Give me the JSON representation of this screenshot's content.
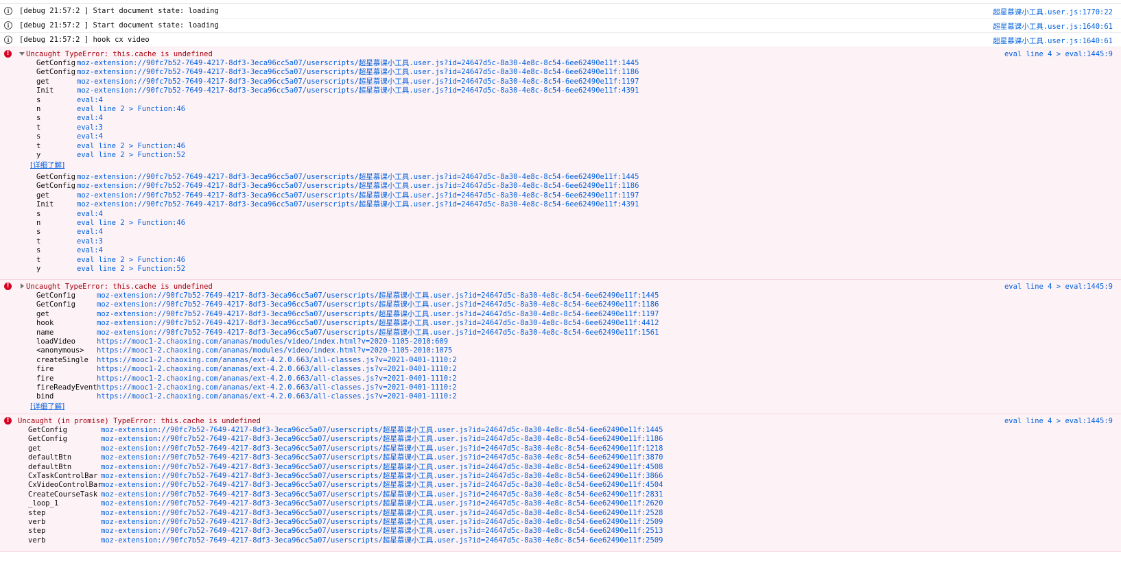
{
  "info_rows": [
    {
      "msg": "[debug 21:57:2 ] Start document state: loading",
      "src": "超星慕课小工具.user.js:1770:22"
    },
    {
      "msg": "[debug 21:57:2 ] Start document state: loading",
      "src": "超星慕课小工具.user.js:1640:61"
    },
    {
      "msg": "[debug 21:57:2 ] hook cx video",
      "src": "超星慕课小工具.user.js:1640:61"
    }
  ],
  "errors": [
    {
      "title": "Uncaught TypeError: this.cache is undefined",
      "src": "eval line 4 > eval:1445:9",
      "learn_more": "[详细了解]",
      "trace1": [
        [
          "GetConfig",
          "moz-extension://90fc7b52-7649-4217-8df3-3eca96cc5a07/userscripts/超星慕课小工具.user.js?id=24647d5c-8a30-4e8c-8c54-6ee62490e11f:1445"
        ],
        [
          "GetConfig",
          "moz-extension://90fc7b52-7649-4217-8df3-3eca96cc5a07/userscripts/超星慕课小工具.user.js?id=24647d5c-8a30-4e8c-8c54-6ee62490e11f:1186"
        ],
        [
          "get",
          "moz-extension://90fc7b52-7649-4217-8df3-3eca96cc5a07/userscripts/超星慕课小工具.user.js?id=24647d5c-8a30-4e8c-8c54-6ee62490e11f:1197"
        ],
        [
          "Init",
          "moz-extension://90fc7b52-7649-4217-8df3-3eca96cc5a07/userscripts/超星慕课小工具.user.js?id=24647d5c-8a30-4e8c-8c54-6ee62490e11f:4391"
        ],
        [
          "s",
          "eval:4"
        ],
        [
          "n",
          "eval line 2 > Function:46"
        ],
        [
          "s",
          "eval:4"
        ],
        [
          "t",
          "eval:3"
        ],
        [
          "s",
          "eval:4"
        ],
        [
          "t",
          "eval line 2 > Function:46"
        ],
        [
          "y",
          "eval line 2 > Function:52"
        ]
      ],
      "trace2": [
        [
          "GetConfig",
          "moz-extension://90fc7b52-7649-4217-8df3-3eca96cc5a07/userscripts/超星慕课小工具.user.js?id=24647d5c-8a30-4e8c-8c54-6ee62490e11f:1445"
        ],
        [
          "GetConfig",
          "moz-extension://90fc7b52-7649-4217-8df3-3eca96cc5a07/userscripts/超星慕课小工具.user.js?id=24647d5c-8a30-4e8c-8c54-6ee62490e11f:1186"
        ],
        [
          "get",
          "moz-extension://90fc7b52-7649-4217-8df3-3eca96cc5a07/userscripts/超星慕课小工具.user.js?id=24647d5c-8a30-4e8c-8c54-6ee62490e11f:1197"
        ],
        [
          "Init",
          "moz-extension://90fc7b52-7649-4217-8df3-3eca96cc5a07/userscripts/超星慕课小工具.user.js?id=24647d5c-8a30-4e8c-8c54-6ee62490e11f:4391"
        ],
        [
          "s",
          "eval:4"
        ],
        [
          "n",
          "eval line 2 > Function:46"
        ],
        [
          "s",
          "eval:4"
        ],
        [
          "t",
          "eval:3"
        ],
        [
          "s",
          "eval:4"
        ],
        [
          "t",
          "eval line 2 > Function:46"
        ],
        [
          "y",
          "eval line 2 > Function:52"
        ]
      ]
    },
    {
      "title": "Uncaught TypeError: this.cache is undefined",
      "src": "eval line 4 > eval:1445:9",
      "learn_more": "[详细了解]",
      "trace1": [
        [
          "GetConfig",
          "moz-extension://90fc7b52-7649-4217-8df3-3eca96cc5a07/userscripts/超星慕课小工具.user.js?id=24647d5c-8a30-4e8c-8c54-6ee62490e11f:1445"
        ],
        [
          "GetConfig",
          "moz-extension://90fc7b52-7649-4217-8df3-3eca96cc5a07/userscripts/超星慕课小工具.user.js?id=24647d5c-8a30-4e8c-8c54-6ee62490e11f:1186"
        ],
        [
          "get",
          "moz-extension://90fc7b52-7649-4217-8df3-3eca96cc5a07/userscripts/超星慕课小工具.user.js?id=24647d5c-8a30-4e8c-8c54-6ee62490e11f:1197"
        ],
        [
          "hook",
          "moz-extension://90fc7b52-7649-4217-8df3-3eca96cc5a07/userscripts/超星慕课小工具.user.js?id=24647d5c-8a30-4e8c-8c54-6ee62490e11f:4412"
        ],
        [
          "name",
          "moz-extension://90fc7b52-7649-4217-8df3-3eca96cc5a07/userscripts/超星慕课小工具.user.js?id=24647d5c-8a30-4e8c-8c54-6ee62490e11f:1561"
        ],
        [
          "loadVideo",
          "https://mooc1-2.chaoxing.com/ananas/modules/video/index.html?v=2020-1105-2010:609"
        ],
        [
          "<anonymous>",
          "https://mooc1-2.chaoxing.com/ananas/modules/video/index.html?v=2020-1105-2010:1075"
        ],
        [
          "createSingle",
          "https://mooc1-2.chaoxing.com/ananas/ext-4.2.0.663/all-classes.js?v=2021-0401-1110:2"
        ],
        [
          "fire",
          "https://mooc1-2.chaoxing.com/ananas/ext-4.2.0.663/all-classes.js?v=2021-0401-1110:2"
        ],
        [
          "fire",
          "https://mooc1-2.chaoxing.com/ananas/ext-4.2.0.663/all-classes.js?v=2021-0401-1110:2"
        ],
        [
          "fireReadyEvent",
          "https://mooc1-2.chaoxing.com/ananas/ext-4.2.0.663/all-classes.js?v=2021-0401-1110:2"
        ],
        [
          "bind",
          "https://mooc1-2.chaoxing.com/ananas/ext-4.2.0.663/all-classes.js?v=2021-0401-1110:2"
        ]
      ]
    },
    {
      "title": "Uncaught (in promise) TypeError: this.cache is undefined",
      "src": "eval line 4 > eval:1445:9",
      "trace1": [
        [
          "GetConfig",
          "moz-extension://90fc7b52-7649-4217-8df3-3eca96cc5a07/userscripts/超星慕课小工具.user.js?id=24647d5c-8a30-4e8c-8c54-6ee62490e11f:1445"
        ],
        [
          "GetConfig",
          "moz-extension://90fc7b52-7649-4217-8df3-3eca96cc5a07/userscripts/超星慕课小工具.user.js?id=24647d5c-8a30-4e8c-8c54-6ee62490e11f:1186"
        ],
        [
          "get",
          "moz-extension://90fc7b52-7649-4217-8df3-3eca96cc5a07/userscripts/超星慕课小工具.user.js?id=24647d5c-8a30-4e8c-8c54-6ee62490e11f:1218"
        ],
        [
          "defaultBtn",
          "moz-extension://90fc7b52-7649-4217-8df3-3eca96cc5a07/userscripts/超星慕课小工具.user.js?id=24647d5c-8a30-4e8c-8c54-6ee62490e11f:3870"
        ],
        [
          "defaultBtn",
          "moz-extension://90fc7b52-7649-4217-8df3-3eca96cc5a07/userscripts/超星慕课小工具.user.js?id=24647d5c-8a30-4e8c-8c54-6ee62490e11f:4508"
        ],
        [
          "CxTaskControlBar",
          "moz-extension://90fc7b52-7649-4217-8df3-3eca96cc5a07/userscripts/超星慕课小工具.user.js?id=24647d5c-8a30-4e8c-8c54-6ee62490e11f:3866"
        ],
        [
          "CxVideoControlBar",
          "moz-extension://90fc7b52-7649-4217-8df3-3eca96cc5a07/userscripts/超星慕课小工具.user.js?id=24647d5c-8a30-4e8c-8c54-6ee62490e11f:4504"
        ],
        [
          "CreateCourseTask",
          "moz-extension://90fc7b52-7649-4217-8df3-3eca96cc5a07/userscripts/超星慕课小工具.user.js?id=24647d5c-8a30-4e8c-8c54-6ee62490e11f:2831"
        ],
        [
          "_loop_1",
          "moz-extension://90fc7b52-7649-4217-8df3-3eca96cc5a07/userscripts/超星慕课小工具.user.js?id=24647d5c-8a30-4e8c-8c54-6ee62490e11f:2620"
        ],
        [
          "step",
          "moz-extension://90fc7b52-7649-4217-8df3-3eca96cc5a07/userscripts/超星慕课小工具.user.js?id=24647d5c-8a30-4e8c-8c54-6ee62490e11f:2528"
        ],
        [
          "verb",
          "moz-extension://90fc7b52-7649-4217-8df3-3eca96cc5a07/userscripts/超星慕课小工具.user.js?id=24647d5c-8a30-4e8c-8c54-6ee62490e11f:2509"
        ],
        [
          "step",
          "moz-extension://90fc7b52-7649-4217-8df3-3eca96cc5a07/userscripts/超星慕课小工具.user.js?id=24647d5c-8a30-4e8c-8c54-6ee62490e11f:2513"
        ],
        [
          "verb",
          "moz-extension://90fc7b52-7649-4217-8df3-3eca96cc5a07/userscripts/超星慕课小工具.user.js?id=24647d5c-8a30-4e8c-8c54-6ee62490e11f:2509"
        ]
      ]
    }
  ],
  "colors": {
    "error_bg": "#fdf2f5",
    "error_text": "#a4000f",
    "link": "#0060df"
  }
}
